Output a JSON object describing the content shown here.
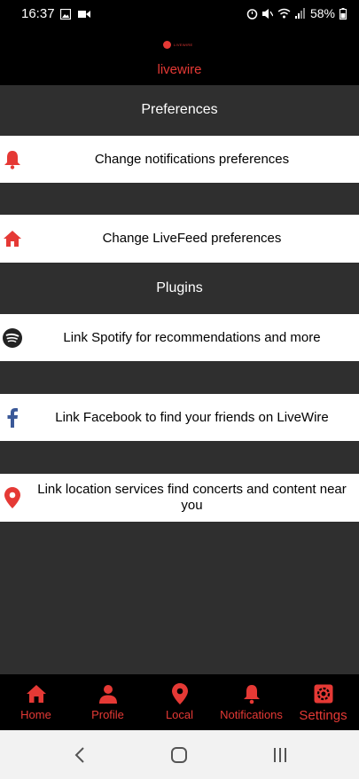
{
  "status_bar": {
    "time": "16:37",
    "battery": "58%"
  },
  "header": {
    "logo_text": "LIVEWIRE",
    "title": "livewire"
  },
  "sections": {
    "preferences": "Preferences",
    "plugins": "Plugins"
  },
  "rows": {
    "notifications": "Change notifications preferences",
    "livefeed": "Change LiveFeed preferences",
    "spotify": "Link Spotify for recommendations and more",
    "facebook": "Link Facebook to find your friends on LiveWire",
    "location": "Link location services find concerts and content near you"
  },
  "nav": {
    "home": "Home",
    "profile": "Profile",
    "local": "Local",
    "notifications": "Notifications",
    "settings": "Settings"
  },
  "colors": {
    "accent": "#e53935",
    "dark_bg": "#2f2f2f",
    "facebook": "#3b5998"
  }
}
